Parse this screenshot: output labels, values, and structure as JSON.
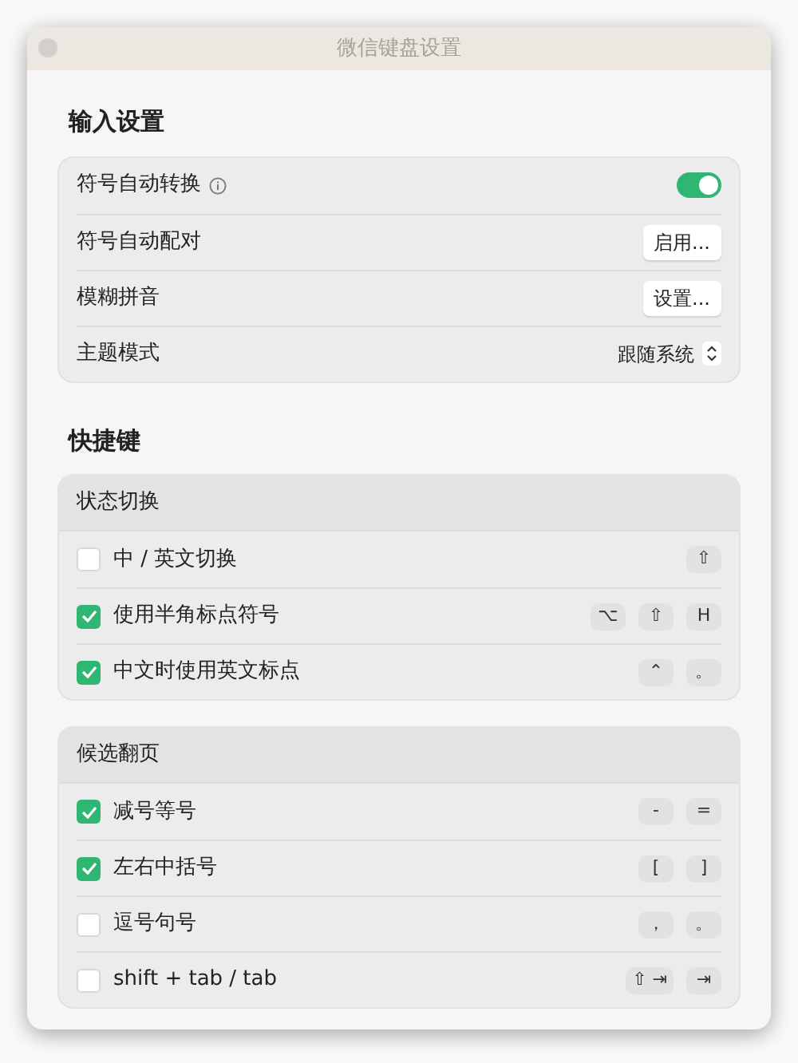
{
  "window": {
    "title": "微信键盘设置"
  },
  "input_settings": {
    "heading": "输入设置",
    "rows": [
      {
        "kind": "toggle",
        "label": "符号自动转换",
        "info": true,
        "on": true
      },
      {
        "kind": "button",
        "label": "符号自动配对",
        "button": "启用..."
      },
      {
        "kind": "button",
        "label": "模糊拼音",
        "button": "设置..."
      },
      {
        "kind": "select",
        "label": "主题模式",
        "value": "跟随系统"
      }
    ]
  },
  "shortcuts": {
    "heading": "快捷键",
    "groups": [
      {
        "title": "状态切换",
        "items": [
          {
            "label": "中 / 英文切换",
            "checked": false,
            "keys": [
              "⇧"
            ]
          },
          {
            "label": "使用半角标点符号",
            "checked": true,
            "keys": [
              "⌥",
              "⇧",
              "H"
            ]
          },
          {
            "label": "中文时使用英文标点",
            "checked": true,
            "keys": [
              "⌃",
              "。"
            ]
          }
        ]
      },
      {
        "title": "候选翻页",
        "items": [
          {
            "label": "减号等号",
            "checked": true,
            "keys": [
              "-",
              "="
            ]
          },
          {
            "label": "左右中括号",
            "checked": true,
            "keys": [
              "[",
              "]"
            ]
          },
          {
            "label": "逗号句号",
            "checked": false,
            "keys": [
              "，",
              "。"
            ]
          },
          {
            "label": "shift + tab / tab",
            "checked": false,
            "keys": [
              "⇧ ⇥",
              "⇥"
            ]
          }
        ]
      }
    ]
  }
}
